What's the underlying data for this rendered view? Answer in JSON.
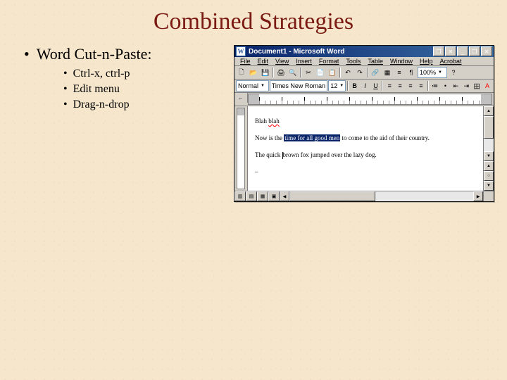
{
  "title": "Combined Strategies",
  "main_bullet": "Word Cut-n-Paste:",
  "sub_bullets": [
    "Ctrl-x, ctrl-p",
    "Edit menu",
    "Drag-n-drop"
  ],
  "word": {
    "app_icon_letter": "W",
    "title": "Document1 - Microsoft Word",
    "window_buttons": {
      "min": "_",
      "max": "❐",
      "close": "✕",
      "mdi_max": "❐",
      "mdi_close": "✕"
    },
    "menu": [
      "File",
      "Edit",
      "View",
      "Insert",
      "Format",
      "Tools",
      "Table",
      "Window",
      "Help",
      "Acrobat"
    ],
    "toolbar1_icons": [
      "🗋",
      "📂",
      "💾",
      "🖨",
      "🔍",
      "✂",
      "📋",
      "📄",
      "↶",
      "↷",
      "🔗",
      "▦",
      "≡",
      "¶"
    ],
    "zoom": "100%",
    "style": "Normal",
    "font": "Times New Roman",
    "size": "12",
    "format_icons": [
      "B",
      "I",
      "U"
    ],
    "align_icons": [
      "≡",
      "≡",
      "≡",
      "≡"
    ],
    "list_icons": [
      "≔",
      "•",
      "⇤",
      "⇥",
      "田",
      "A"
    ],
    "doc": {
      "p1a": "Blah ",
      "p1b": "blah",
      "p2a": "Now is the ",
      "p2_sel": "time for all good men",
      "p2b": " to come to the aid of their country.",
      "p3a": "The quick ",
      "p3b": "brown fox jumped over the lazy dog.",
      "p4": "–"
    },
    "scroll": {
      "up": "▲",
      "down": "▼",
      "left": "◀",
      "right": "▶",
      "prev": "▲▲",
      "sel": "○",
      "next": "▼▼"
    },
    "view_icons": [
      "▥",
      "▤",
      "▦",
      "▣"
    ],
    "ruler_corner": "⌐"
  }
}
